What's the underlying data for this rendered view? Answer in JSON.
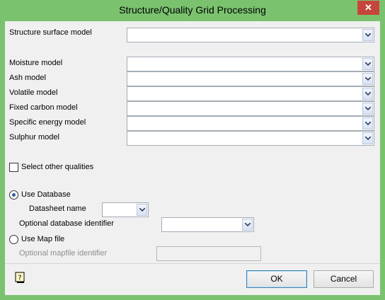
{
  "window": {
    "title": "Structure/Quality Grid Processing",
    "close_glyph": "✕"
  },
  "structure": {
    "label": "Structure surface model",
    "value": ""
  },
  "quality_models": [
    {
      "label": "Moisture model",
      "value": ""
    },
    {
      "label": "Ash model",
      "value": ""
    },
    {
      "label": "Volatile model",
      "value": ""
    },
    {
      "label": "Fixed carbon model",
      "value": ""
    },
    {
      "label": "Specific energy model",
      "value": ""
    },
    {
      "label": "Sulphur model",
      "value": ""
    }
  ],
  "select_other": {
    "label": "Select other qualities",
    "checked": false
  },
  "database": {
    "radio_label": "Use Database",
    "selected": true,
    "datasheet_label": "Datasheet name",
    "datasheet_value": "",
    "identifier_label": "Optional database identifier",
    "identifier_value": ""
  },
  "mapfile": {
    "radio_label": "Use Map file",
    "selected": false,
    "identifier_label": "Optional mapfile identifier",
    "identifier_value": ""
  },
  "footer": {
    "help_icon": "help-icon",
    "ok_label": "OK",
    "cancel_label": "Cancel"
  },
  "colors": {
    "title_bar": "#7bc26f",
    "close_button": "#c7463c",
    "dialog_background": "#f0f0f0",
    "disabled_text": "#8d8d8d"
  }
}
